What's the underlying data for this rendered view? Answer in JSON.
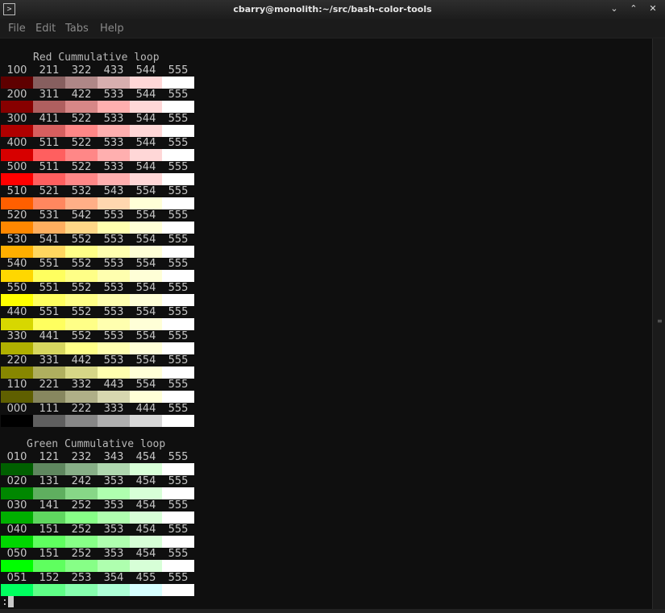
{
  "window": {
    "title": "cbarry@monolith:~/src/bash-color-tools",
    "app_icon": "terminal-icon",
    "controls": [
      "minimize",
      "maximize",
      "close"
    ],
    "control_glyphs": [
      "⌄",
      "⌃",
      "✕"
    ]
  },
  "menubar": {
    "items": [
      "File",
      "Edit",
      "Tabs",
      "Help"
    ]
  },
  "terminal": {
    "prompt": ":",
    "sections": [
      {
        "title": "Red Cummulative loop",
        "rows": [
          {
            "labels": [
              "100",
              "211",
              "322",
              "433",
              "544",
              "555"
            ],
            "colors": [
              "#5f0000",
              "#875f5f",
              "#af8787",
              "#d7afaf",
              "#ffd7d7",
              "#ffffff"
            ]
          },
          {
            "labels": [
              "200",
              "311",
              "422",
              "533",
              "544",
              "555"
            ],
            "colors": [
              "#870000",
              "#af5f5f",
              "#d78787",
              "#ffafaf",
              "#ffd7d7",
              "#ffffff"
            ]
          },
          {
            "labels": [
              "300",
              "411",
              "522",
              "533",
              "544",
              "555"
            ],
            "colors": [
              "#af0000",
              "#d75f5f",
              "#ff8787",
              "#ffafaf",
              "#ffd7d7",
              "#ffffff"
            ]
          },
          {
            "labels": [
              "400",
              "511",
              "522",
              "533",
              "544",
              "555"
            ],
            "colors": [
              "#d70000",
              "#ff5f5f",
              "#ff8787",
              "#ffafaf",
              "#ffd7d7",
              "#ffffff"
            ]
          },
          {
            "labels": [
              "500",
              "511",
              "522",
              "533",
              "544",
              "555"
            ],
            "colors": [
              "#ff0000",
              "#ff5f5f",
              "#ff8787",
              "#ffafaf",
              "#ffd7d7",
              "#ffffff"
            ]
          },
          {
            "labels": [
              "510",
              "521",
              "532",
              "543",
              "554",
              "555"
            ],
            "colors": [
              "#ff5f00",
              "#ff875f",
              "#ffaf87",
              "#ffd7af",
              "#ffffd7",
              "#ffffff"
            ]
          },
          {
            "labels": [
              "520",
              "531",
              "542",
              "553",
              "554",
              "555"
            ],
            "colors": [
              "#ff8700",
              "#ffaf5f",
              "#ffd787",
              "#ffffaf",
              "#ffffd7",
              "#ffffff"
            ]
          },
          {
            "labels": [
              "530",
              "541",
              "552",
              "553",
              "554",
              "555"
            ],
            "colors": [
              "#ffaf00",
              "#ffd75f",
              "#ffff87",
              "#ffffaf",
              "#ffffd7",
              "#ffffff"
            ]
          },
          {
            "labels": [
              "540",
              "551",
              "552",
              "553",
              "554",
              "555"
            ],
            "colors": [
              "#ffd700",
              "#ffff5f",
              "#ffff87",
              "#ffffaf",
              "#ffffd7",
              "#ffffff"
            ]
          },
          {
            "labels": [
              "550",
              "551",
              "552",
              "553",
              "554",
              "555"
            ],
            "colors": [
              "#ffff00",
              "#ffff5f",
              "#ffff87",
              "#ffffaf",
              "#ffffd7",
              "#ffffff"
            ]
          },
          {
            "labels": [
              "440",
              "551",
              "552",
              "553",
              "554",
              "555"
            ],
            "colors": [
              "#d7d700",
              "#ffff5f",
              "#ffff87",
              "#ffffaf",
              "#ffffd7",
              "#ffffff"
            ]
          },
          {
            "labels": [
              "330",
              "441",
              "552",
              "553",
              "554",
              "555"
            ],
            "colors": [
              "#afaf00",
              "#d7d75f",
              "#ffff87",
              "#ffffaf",
              "#ffffd7",
              "#ffffff"
            ]
          },
          {
            "labels": [
              "220",
              "331",
              "442",
              "553",
              "554",
              "555"
            ],
            "colors": [
              "#878700",
              "#afaf5f",
              "#d7d787",
              "#ffffaf",
              "#ffffd7",
              "#ffffff"
            ]
          },
          {
            "labels": [
              "110",
              "221",
              "332",
              "443",
              "554",
              "555"
            ],
            "colors": [
              "#5f5f00",
              "#87875f",
              "#afaf87",
              "#d7d7af",
              "#ffffd7",
              "#ffffff"
            ]
          },
          {
            "labels": [
              "000",
              "111",
              "222",
              "333",
              "444",
              "555"
            ],
            "colors": [
              "#000000",
              "#5f5f5f",
              "#878787",
              "#afafaf",
              "#d7d7d7",
              "#ffffff"
            ]
          }
        ]
      },
      {
        "title": "Green Cummulative loop",
        "rows": [
          {
            "labels": [
              "010",
              "121",
              "232",
              "343",
              "454",
              "555"
            ],
            "colors": [
              "#005f00",
              "#5f875f",
              "#87af87",
              "#afd7af",
              "#d7ffd7",
              "#ffffff"
            ]
          },
          {
            "labels": [
              "020",
              "131",
              "242",
              "353",
              "454",
              "555"
            ],
            "colors": [
              "#008700",
              "#5faf5f",
              "#87d787",
              "#afffaf",
              "#d7ffd7",
              "#ffffff"
            ]
          },
          {
            "labels": [
              "030",
              "141",
              "252",
              "353",
              "454",
              "555"
            ],
            "colors": [
              "#00af00",
              "#5fd75f",
              "#87ff87",
              "#afffaf",
              "#d7ffd7",
              "#ffffff"
            ]
          },
          {
            "labels": [
              "040",
              "151",
              "252",
              "353",
              "454",
              "555"
            ],
            "colors": [
              "#00d700",
              "#5fff5f",
              "#87ff87",
              "#afffaf",
              "#d7ffd7",
              "#ffffff"
            ]
          },
          {
            "labels": [
              "050",
              "151",
              "252",
              "353",
              "454",
              "555"
            ],
            "colors": [
              "#00ff00",
              "#5fff5f",
              "#87ff87",
              "#afffaf",
              "#d7ffd7",
              "#ffffff"
            ]
          },
          {
            "labels": [
              "051",
              "152",
              "253",
              "354",
              "455",
              "555"
            ],
            "colors": [
              "#00ff5f",
              "#5fff87",
              "#87ffaf",
              "#afffd7",
              "#d7ffff",
              "#ffffff"
            ]
          }
        ]
      }
    ]
  }
}
